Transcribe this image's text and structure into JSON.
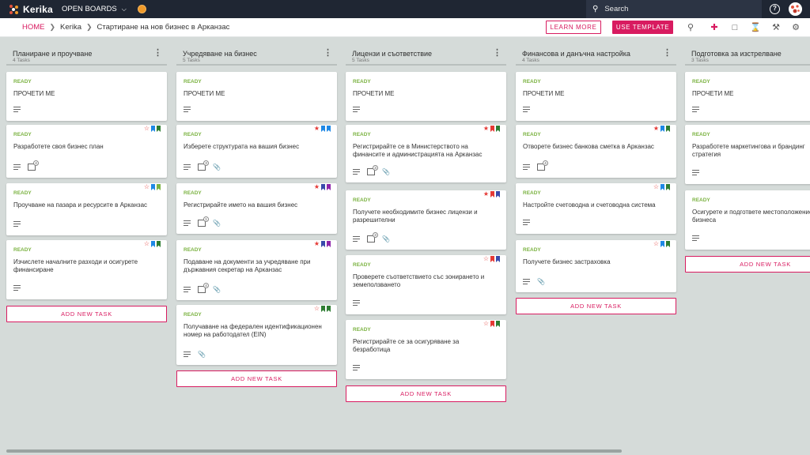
{
  "app": {
    "name": "Kerika",
    "open_boards": "OPEN BOARDS"
  },
  "search": {
    "placeholder": "Search"
  },
  "breadcrumb": {
    "home": "HOME",
    "org": "Kerika",
    "board": "Стартиране на нов бизнес в Арканзас"
  },
  "actions": {
    "learn_more": "LEARN MORE",
    "use_template": "USE TEMPLATE"
  },
  "colors": {
    "accent": "#d81b60",
    "ready": "#7cb342",
    "topbar": "#1f2633",
    "board_bg": "#d5dbd9"
  },
  "toolbar_icons": [
    "search-icon",
    "add-person-icon",
    "chat-icon",
    "attachment-icon",
    "wrench-icon",
    "settings-icon"
  ],
  "add_task_label": "ADD NEW TASK",
  "columns": [
    {
      "title": "Планиране и проучване",
      "count": "4 Tasks",
      "cards": [
        {
          "status": "READY",
          "title": "ПРОЧЕТИ МЕ"
        },
        {
          "status": "READY",
          "title": "Разработете своя бизнес план",
          "checklist": "4"
        },
        {
          "status": "READY",
          "title": "Проучване на пазара и ресурсите в Арканзас"
        },
        {
          "status": "READY",
          "title": "Изчислете началните разходи и осигурете финансиране"
        }
      ]
    },
    {
      "title": "Учредяване на бизнес",
      "count": "5 Tasks",
      "cards": [
        {
          "status": "READY",
          "title": "ПРОЧЕТИ МЕ"
        },
        {
          "status": "READY",
          "title": "Изберете структурата на вашия бизнес",
          "checklist": "3"
        },
        {
          "status": "READY",
          "title": "Регистрирайте името на вашия бизнес",
          "checklist": "1"
        },
        {
          "status": "READY",
          "title": "Подаване на документи за учредяване при държавния секретар на Арканзас",
          "checklist": "4"
        },
        {
          "status": "READY",
          "title": "Получаване на федерален идентификационен номер на работодател (EIN)"
        }
      ]
    },
    {
      "title": "Лицензи и съответствие",
      "count": "5 Tasks",
      "cards": [
        {
          "status": "READY",
          "title": "ПРОЧЕТИ МЕ"
        },
        {
          "status": "READY",
          "title": "Регистрирайте се в Министерството на финансите и администрацията на Арканзас",
          "checklist": "3"
        },
        {
          "status": "READY",
          "title": "Получете необходимите бизнес лицензи и разрешителни",
          "checklist": "3"
        },
        {
          "status": "READY",
          "title": "Проверете съответствието със зонирането и земеползването"
        },
        {
          "status": "READY",
          "title": "Регистрирайте се за осигуряване за безработица"
        }
      ]
    },
    {
      "title": "Финансова и данъчна настройка",
      "count": "4 Tasks",
      "cards": [
        {
          "status": "READY",
          "title": "ПРОЧЕТИ МЕ"
        },
        {
          "status": "READY",
          "title": "Отворете бизнес банкова сметка в Арканзас",
          "checklist": "4"
        },
        {
          "status": "READY",
          "title": "Настройте счетоводна и счетоводна система"
        },
        {
          "status": "READY",
          "title": "Получете бизнес застраховка"
        }
      ]
    },
    {
      "title": "Подготовка за изстрелване",
      "count": "3 Tasks",
      "cards": [
        {
          "status": "READY",
          "title": "ПРОЧЕТИ МЕ"
        },
        {
          "status": "READY",
          "title": "Разработете маркетингова и брандинг стратегия"
        },
        {
          "status": "READY",
          "title": "Осигурете и подгответе местоположение на бизнеса"
        }
      ]
    }
  ]
}
